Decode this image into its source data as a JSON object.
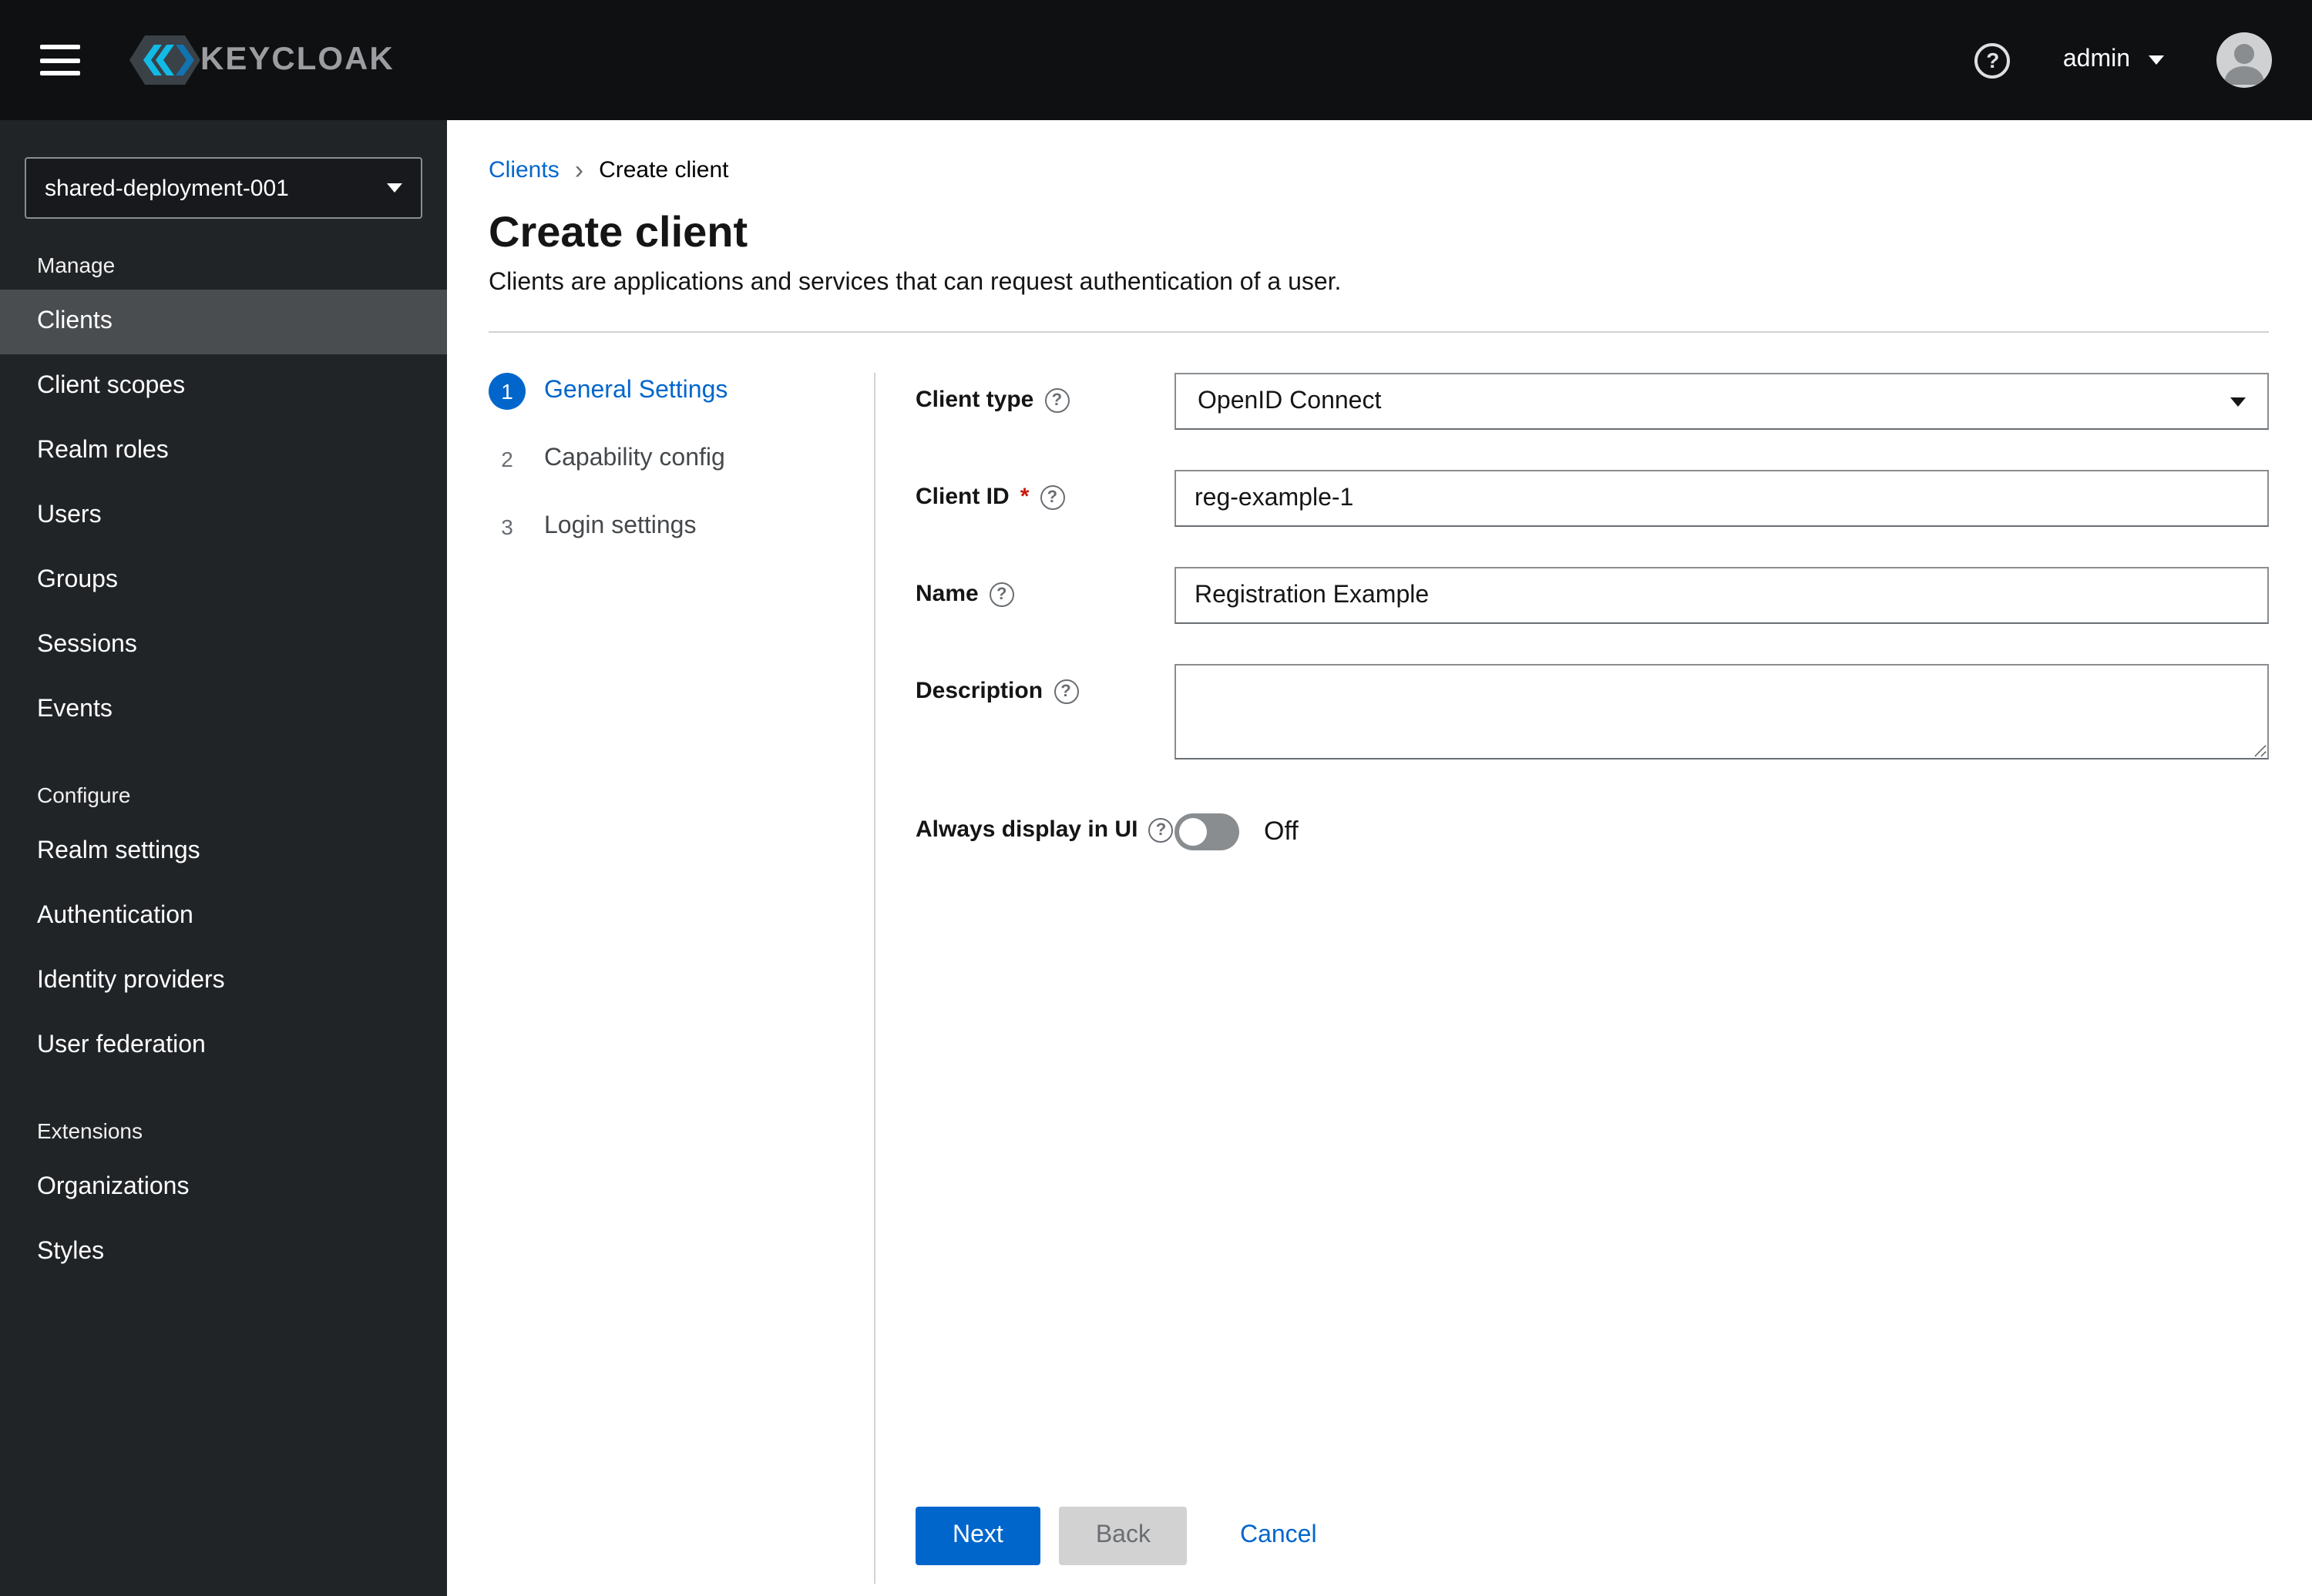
{
  "header": {
    "brand_text": "KEYCLOAK",
    "username": "admin"
  },
  "sidebar": {
    "realm_selector": "shared-deployment-001",
    "sections": [
      {
        "label": "Manage",
        "items": [
          {
            "label": "Clients"
          },
          {
            "label": "Client scopes"
          },
          {
            "label": "Realm roles"
          },
          {
            "label": "Users"
          },
          {
            "label": "Groups"
          },
          {
            "label": "Sessions"
          },
          {
            "label": "Events"
          }
        ]
      },
      {
        "label": "Configure",
        "items": [
          {
            "label": "Realm settings"
          },
          {
            "label": "Authentication"
          },
          {
            "label": "Identity providers"
          },
          {
            "label": "User federation"
          }
        ]
      },
      {
        "label": "Extensions",
        "items": [
          {
            "label": "Organizations"
          },
          {
            "label": "Styles"
          }
        ]
      }
    ]
  },
  "breadcrumb": {
    "clients": "Clients",
    "current": "Create client"
  },
  "page": {
    "title": "Create client",
    "subtitle": "Clients are applications and services that can request authentication of a user."
  },
  "wizard": {
    "steps": [
      {
        "num": "1",
        "label": "General Settings"
      },
      {
        "num": "2",
        "label": "Capability config"
      },
      {
        "num": "3",
        "label": "Login settings"
      }
    ]
  },
  "form": {
    "client_type": {
      "label": "Client type",
      "value": "OpenID Connect"
    },
    "client_id": {
      "label": "Client ID",
      "required_mark": "*",
      "value": "reg-example-1"
    },
    "name": {
      "label": "Name",
      "value": "Registration Example"
    },
    "description": {
      "label": "Description",
      "value": ""
    },
    "always_display": {
      "label": "Always display in UI",
      "state": "Off"
    }
  },
  "actions": {
    "next": "Next",
    "back": "Back",
    "cancel": "Cancel"
  },
  "colors": {
    "primary": "#0066cc",
    "link": "#0066cc"
  }
}
